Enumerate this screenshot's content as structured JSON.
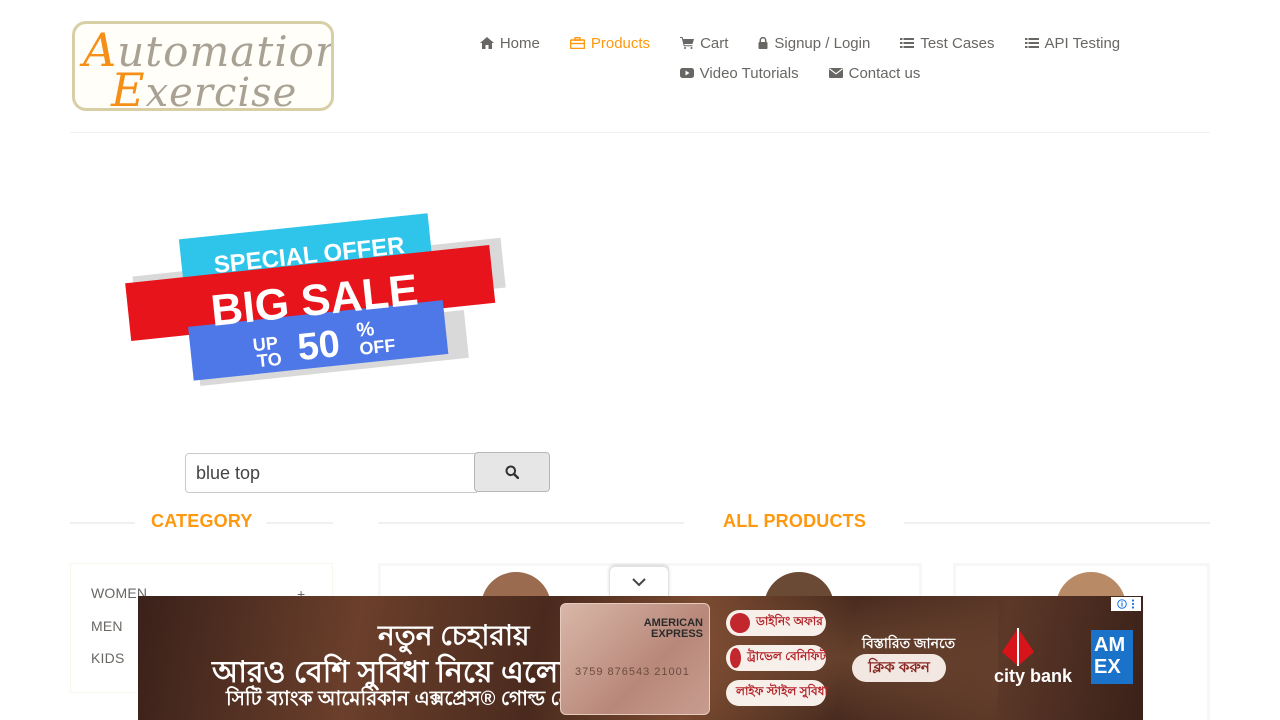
{
  "logo": {
    "line1_cap": "A",
    "line1_rest": "utomation",
    "line2_cap": "E",
    "line2_rest": "xercise"
  },
  "nav": {
    "row1": [
      {
        "label": "Home",
        "icon": "home-icon"
      },
      {
        "label": "Products",
        "icon": "products-icon",
        "active": true
      },
      {
        "label": "Cart",
        "icon": "cart-icon"
      },
      {
        "label": "Signup / Login",
        "icon": "lock-icon"
      },
      {
        "label": "Test Cases",
        "icon": "list-icon"
      },
      {
        "label": "API Testing",
        "icon": "list-icon"
      }
    ],
    "row2": [
      {
        "label": "Video Tutorials",
        "icon": "youtube-icon"
      },
      {
        "label": "Contact us",
        "icon": "envelope-icon"
      }
    ]
  },
  "banner": {
    "top": "SPECIAL OFFER",
    "middle": "BIG SALE",
    "up": "UP",
    "to": "TO",
    "pct": "50",
    "pct_sign": "%",
    "off": "OFF"
  },
  "search": {
    "value": "blue top",
    "button_icon": "search-icon"
  },
  "sections": {
    "category": "CATEGORY",
    "all_products": "ALL PRODUCTS"
  },
  "categories": [
    {
      "label": "WOMEN",
      "expander": "+"
    },
    {
      "label": "MEN"
    },
    {
      "label": "KIDS"
    }
  ],
  "ad": {
    "headline1": "নতুন চেহারায়",
    "headline2": "আরও বেশি সুবিধা নিয়ে এলো",
    "headline3": "সিটি ব্যাংক আমেরিকান এক্সপ্রেস® গোল্ড ক্রেডিট কার্ড",
    "card_brand_line1": "AMERICAN",
    "card_brand_line2": "EXPRESS",
    "card_number": "3759 876543 21001",
    "pill1": "ডাইনিং অফার",
    "pill2": "ট্রাভেল বেনিফিট",
    "pill3": "লাইফ স্টাইল সুবিধা",
    "more_text": "বিস্তারিত জানতে",
    "cta": "ক্লিক করুন",
    "bank": "city bank",
    "amex_logo": "AM EX",
    "colors": {
      "brand_red": "#c1272d",
      "amex_blue": "#1a73c9"
    }
  },
  "colors": {
    "accent": "#fe980f",
    "text": "#696763"
  }
}
